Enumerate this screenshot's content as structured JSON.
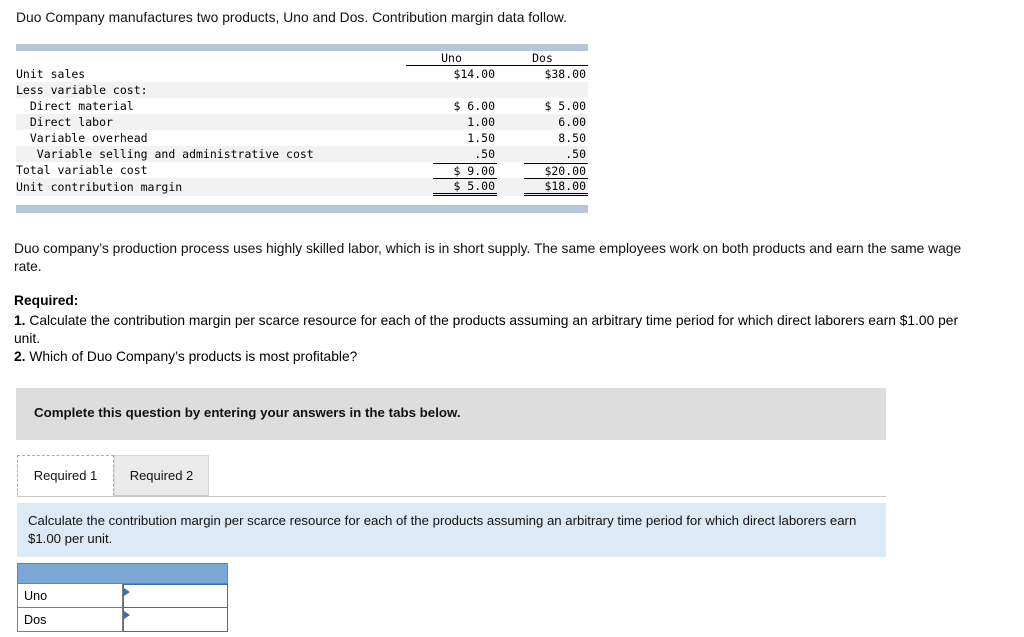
{
  "intro": "Duo Company manufactures two products, Uno and Dos. Contribution margin data follow.",
  "table": {
    "columns": [
      "",
      "Uno",
      "Dos"
    ],
    "rows": [
      {
        "label": "Unit sales",
        "uno": "$14.00",
        "dos": "$38.00",
        "shade": false,
        "rule": "none"
      },
      {
        "label": "Less variable cost:",
        "uno": "",
        "dos": "",
        "shade": true,
        "rule": "none"
      },
      {
        "label": "  Direct material",
        "uno": "$ 6.00",
        "dos": "$ 5.00",
        "shade": false,
        "rule": "none"
      },
      {
        "label": "  Direct labor",
        "uno": "1.00",
        "dos": "6.00",
        "shade": true,
        "rule": "none"
      },
      {
        "label": "  Variable overhead",
        "uno": "1.50",
        "dos": "8.50",
        "shade": false,
        "rule": "none"
      },
      {
        "label": "   Variable selling and administrative cost",
        "uno": ".50",
        "dos": ".50",
        "shade": true,
        "rule": "none"
      },
      {
        "label": "Total variable cost",
        "uno": "$ 9.00",
        "dos": "$20.00",
        "shade": false,
        "rule": "top"
      },
      {
        "label": "Unit contribution margin",
        "uno": "$ 5.00",
        "dos": "$18.00",
        "shade": true,
        "rule": "double"
      }
    ]
  },
  "paragraph1": "Duo company’s production process uses highly skilled labor, which is in short supply. The same employees work on both products and earn the same wage rate.",
  "required_heading": "Required:",
  "requirement1_number": "1.",
  "requirement1": "Calculate the contribution margin per scarce resource for each of the products assuming an arbitrary time period for which direct laborers earn $1.00 per unit.",
  "requirement2_number": "2.",
  "requirement2": "Which of Duo Company’s products is most profitable?",
  "banner": "Complete this question by entering your answers in the tabs below.",
  "tabs": [
    {
      "label": "Required 1",
      "active": true
    },
    {
      "label": "Required 2",
      "active": false
    }
  ],
  "instruction": "Calculate the contribution margin per scarce resource for each of the products assuming an arbitrary time period for which direct laborers earn $1.00 per unit.",
  "answer_grid": {
    "header": "",
    "rows": [
      {
        "label": "Uno",
        "value": ""
      },
      {
        "label": "Dos",
        "value": ""
      }
    ]
  },
  "colors": {
    "table_bar": "#b9c6d8",
    "banner": "#dddddd",
    "instruction_box": "#dce9f7",
    "grid_header": "#7ba7d7"
  }
}
